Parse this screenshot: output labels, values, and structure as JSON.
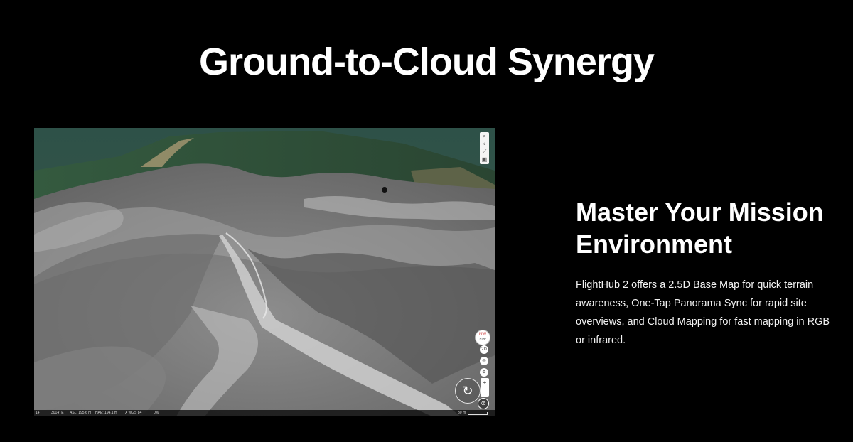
{
  "page": {
    "title": "Ground-to-Cloud Synergy"
  },
  "viewer": {
    "toolbar_top": [
      {
        "icon": "search-icon",
        "glyph": "⌕"
      },
      {
        "icon": "location-icon",
        "glyph": "⌖"
      },
      {
        "icon": "ruler-icon",
        "glyph": "⟋"
      },
      {
        "icon": "layers-icon",
        "glyph": "▣"
      }
    ],
    "compass": {
      "label": "NW",
      "heading": "318°"
    },
    "mode_2d": "2D",
    "rotate_glyph": "↻",
    "zoom_in": "+",
    "zoom_out": "−",
    "status": {
      "left_num": "14",
      "lon": "3014\" E",
      "asl": "ASL: 195.6 m",
      "hae": "HAE: 194.1 m",
      "datum": "WGS 84",
      "percent": "0%",
      "scale": "30 m"
    }
  },
  "panel": {
    "title": "Master Your Mission Environment",
    "description": "FlightHub 2 offers a 2.5D Base Map for quick terrain awareness, One-Tap Panorama Sync for rapid site overviews, and Cloud Mapping for fast mapping in RGB or infrared."
  },
  "colors": {
    "background": "#000000",
    "text": "#ffffff",
    "terrain": "#7a7a7a",
    "forest": "#2f4a35",
    "sea": "#2e5148"
  }
}
